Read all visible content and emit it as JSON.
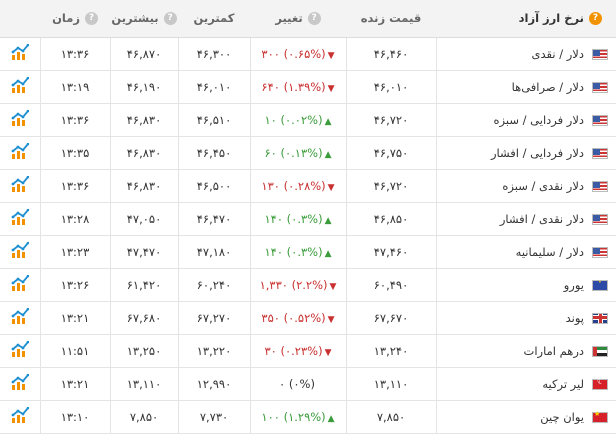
{
  "header": {
    "title": "نرخ ارز آزاد",
    "price": "قیمت زنده",
    "change": "تغییر",
    "low": "کمترین",
    "high": "بیشترین",
    "time": "زمان"
  },
  "colors": {
    "positive": "#3a9c3a",
    "negative": "#c93030",
    "accent": "#f39200",
    "chart_icon": "#1e8fd0"
  },
  "rows": [
    {
      "name": "دلار / نقدی",
      "flag": "us",
      "price": "۴۶,۴۶۰",
      "dir": "neg",
      "arrow": "▼",
      "change": "۳۰۰ (۰.۶۵%)",
      "low": "۴۶,۳۰۰",
      "high": "۴۶,۸۷۰",
      "time": "۱۳:۳۶"
    },
    {
      "name": "دلار / صرافی‌ها",
      "flag": "us",
      "price": "۴۶,۰۱۰",
      "dir": "neg",
      "arrow": "▼",
      "change": "۶۴۰ (۱.۳۹%)",
      "low": "۴۶,۰۱۰",
      "high": "۴۶,۱۹۰",
      "time": "۱۳:۱۹"
    },
    {
      "name": "دلار فردایی / سبزه",
      "flag": "us",
      "price": "۴۶,۷۲۰",
      "dir": "pos",
      "arrow": "▲",
      "change": "۱۰ (۰.۰۲%)",
      "low": "۴۶,۵۱۰",
      "high": "۴۶,۸۳۰",
      "time": "۱۳:۳۶"
    },
    {
      "name": "دلار فردایی / افشار",
      "flag": "us",
      "price": "۴۶,۷۵۰",
      "dir": "pos",
      "arrow": "▲",
      "change": "۶۰ (۰.۱۳%)",
      "low": "۴۶,۴۵۰",
      "high": "۴۶,۸۳۰",
      "time": "۱۳:۳۵"
    },
    {
      "name": "دلار نقدی / سبزه",
      "flag": "us",
      "price": "۴۶,۷۲۰",
      "dir": "neg",
      "arrow": "▼",
      "change": "۱۳۰ (۰.۲۸%)",
      "low": "۴۶,۵۰۰",
      "high": "۴۶,۸۳۰",
      "time": "۱۳:۳۶"
    },
    {
      "name": "دلار نقدی / افشار",
      "flag": "us",
      "price": "۴۶,۸۵۰",
      "dir": "pos",
      "arrow": "▲",
      "change": "۱۴۰ (۰.۳%)",
      "low": "۴۶,۴۷۰",
      "high": "۴۷,۰۵۰",
      "time": "۱۳:۲۸"
    },
    {
      "name": "دلار / سلیمانیه",
      "flag": "us",
      "price": "۴۷,۴۶۰",
      "dir": "pos",
      "arrow": "▲",
      "change": "۱۴۰ (۰.۳%)",
      "low": "۴۷,۱۸۰",
      "high": "۴۷,۴۷۰",
      "time": "۱۳:۲۳"
    },
    {
      "name": "یورو",
      "flag": "eu",
      "price": "۶۰,۴۹۰",
      "dir": "neg",
      "arrow": "▼",
      "change": "۱,۳۳۰ (۲.۲%)",
      "low": "۶۰,۲۴۰",
      "high": "۶۱,۴۲۰",
      "time": "۱۳:۲۶"
    },
    {
      "name": "پوند",
      "flag": "gb",
      "price": "۶۷,۶۷۰",
      "dir": "neg",
      "arrow": "▼",
      "change": "۳۵۰ (۰.۵۲%)",
      "low": "۶۷,۲۷۰",
      "high": "۶۷,۶۸۰",
      "time": "۱۳:۲۱"
    },
    {
      "name": "درهم امارات",
      "flag": "ae",
      "price": "۱۳,۲۴۰",
      "dir": "neg",
      "arrow": "▼",
      "change": "۳۰ (۰.۲۳%)",
      "low": "۱۳,۲۲۰",
      "high": "۱۳,۲۵۰",
      "time": "۱۱:۵۱"
    },
    {
      "name": "لیر ترکیه",
      "flag": "tr",
      "price": "۱۳,۱۱۰",
      "dir": "zero",
      "arrow": "",
      "change": "۰ (۰%)",
      "low": "۱۲,۹۹۰",
      "high": "۱۳,۱۱۰",
      "time": "۱۳:۲۱"
    },
    {
      "name": "یوان چین",
      "flag": "cn",
      "price": "۷,۸۵۰",
      "dir": "pos",
      "arrow": "▲",
      "change": "۱۰۰ (۱.۲۹%)",
      "low": "۷,۷۳۰",
      "high": "۷,۸۵۰",
      "time": "۱۳:۱۰"
    }
  ]
}
